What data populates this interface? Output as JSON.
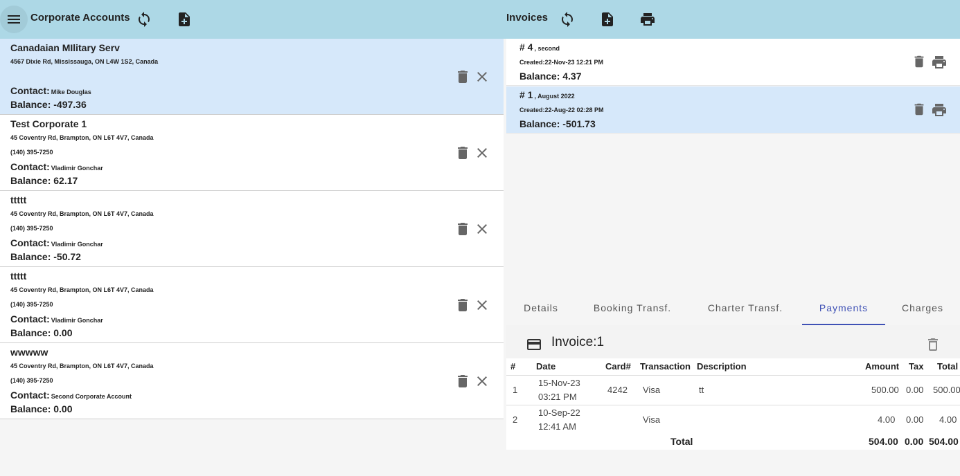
{
  "left_header": {
    "title": "Corporate Accounts"
  },
  "right_header": {
    "title": "Invoices"
  },
  "accounts": [
    {
      "name": "Canadaian MIlitary Serv",
      "address": "4567 Dixie Rd, Mississauga, ON L4W 1S2, Canada",
      "phone": "",
      "contact_label": "Contact:",
      "contact": "Mike Douglas",
      "balance": "Balance: -497.36",
      "selected": true
    },
    {
      "name": "Test Corporate 1",
      "address": "45 Coventry Rd, Brampton, ON L6T 4V7, Canada",
      "phone": "(140) 395-7250",
      "contact_label": "Contact:",
      "contact": "Vladimir Gonchar",
      "balance": "Balance: 62.17",
      "selected": false
    },
    {
      "name": "ttttt",
      "address": "45 Coventry Rd, Brampton, ON L6T 4V7, Canada",
      "phone": "(140) 395-7250",
      "contact_label": "Contact:",
      "contact": "Vladimir Gonchar",
      "balance": "Balance: -50.72",
      "selected": false
    },
    {
      "name": "ttttt",
      "address": "45 Coventry Rd, Brampton, ON L6T 4V7, Canada",
      "phone": "(140) 395-7250",
      "contact_label": "Contact:",
      "contact": "Vladimir Gonchar",
      "balance": "Balance: 0.00",
      "selected": false
    },
    {
      "name": "wwwww",
      "address": "45 Coventry Rd, Brampton, ON L6T 4V7, Canada",
      "phone": "(140) 395-7250",
      "contact_label": "Contact:",
      "contact": "Second Corporate Account",
      "balance": "Balance: 0.00",
      "selected": false
    }
  ],
  "invoices": [
    {
      "number": "# 4",
      "desc": ", second",
      "created": "Created:22-Nov-23 12:21 PM",
      "balance": "Balance: 4.37",
      "selected": false
    },
    {
      "number": "# 1",
      "desc": ", August 2022",
      "created": "Created:22-Aug-22 02:28 PM",
      "balance": "Balance: -501.73",
      "selected": true
    }
  ],
  "tabs": [
    {
      "label": "Details",
      "active": false
    },
    {
      "label": "Booking Transf.",
      "active": false
    },
    {
      "label": "Charter Transf.",
      "active": false
    },
    {
      "label": "Payments",
      "active": true
    },
    {
      "label": "Charges",
      "active": false
    }
  ],
  "payments": {
    "title": "Invoice:1",
    "columns": [
      "#",
      "Date",
      "Card#",
      "Transaction",
      "Description",
      "Amount",
      "Tax",
      "Total"
    ],
    "rows": [
      {
        "num": "1",
        "date": "15-Nov-23",
        "time": "03:21 PM",
        "card": "4242",
        "transaction": "Visa",
        "description": "tt",
        "amount": "500.00",
        "tax": "0.00",
        "total": "500.00"
      },
      {
        "num": "2",
        "date": "10-Sep-22",
        "time": "12:41 AM",
        "card": "",
        "transaction": "Visa",
        "description": "",
        "amount": "4.00",
        "tax": "0.00",
        "total": "4.00"
      }
    ],
    "total_label": "Total",
    "total_amount": "504.00",
    "total_tax": "0.00",
    "total_total": "504.00"
  },
  "colors": {
    "header_bg": "#add8e6",
    "selected_bg": "#d6e8fa",
    "tab_active": "#3f51b5"
  }
}
